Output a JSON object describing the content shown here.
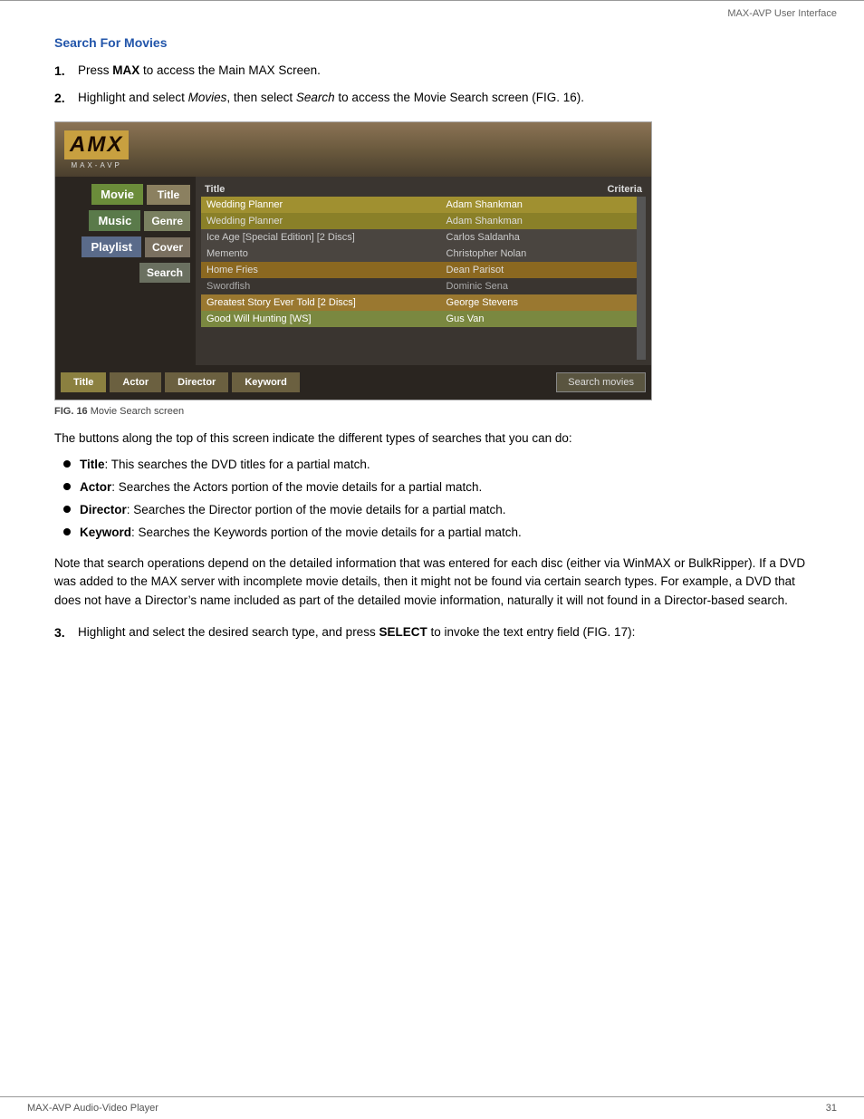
{
  "header": {
    "title": "MAX-AVP User Interface"
  },
  "section": {
    "heading": "Search For Movies",
    "step1": {
      "num": "1.",
      "text_before": "Press ",
      "bold": "MAX",
      "text_after": " to access the Main MAX Screen."
    },
    "step2": {
      "num": "2.",
      "text_before": "Highlight and select ",
      "italic1": "Movies",
      "text_middle": ", then select ",
      "italic2": "Search",
      "text_after": " to access the Movie Search screen (FIG. 16)."
    },
    "step3": {
      "num": "3.",
      "text_before": "Highlight and select the desired search type, and press ",
      "bold": "SELECT",
      "text_after": " to invoke the text entry field (FIG. 17):"
    }
  },
  "screenshot": {
    "logo_text": "AMX",
    "logo_sub": "MAX-AVP",
    "sidebar": {
      "movie_label": "Movie",
      "title_label": "Title",
      "music_label": "Music",
      "genre_label": "Genre",
      "playlist_label": "Playlist",
      "cover_label": "Cover",
      "search_label": "Search"
    },
    "table": {
      "col1": "Title",
      "col2": "Criteria",
      "rows": [
        {
          "title": "Wedding Planner",
          "criteria": "Adam Shankman",
          "style": "highlight"
        },
        {
          "title": "Wedding Planner",
          "criteria": "Adam Shankman",
          "style": "highlight2"
        },
        {
          "title": "Ice Age [Special Edition] [2 Discs]",
          "criteria": "Carlos Saldanha",
          "style": "normal"
        },
        {
          "title": "Memento",
          "criteria": "Christopher Nolan",
          "style": "normal"
        },
        {
          "title": "Home Fries",
          "criteria": "Dean Parisot",
          "style": "orange"
        },
        {
          "title": "Swordfish",
          "criteria": "Dominic Sena",
          "style": "dark"
        },
        {
          "title": "Greatest Story Ever Told [2 Discs]",
          "criteria": "George Stevens",
          "style": "orange-highlight"
        },
        {
          "title": "Good Will Hunting [WS]",
          "criteria": "Gus Van",
          "style": "highlight-green"
        }
      ]
    },
    "bottom_buttons": [
      "Title",
      "Actor",
      "Director",
      "Keyword"
    ],
    "search_movies_btn": "Search movies"
  },
  "fig_caption": {
    "label": "FIG. 16",
    "text": "Movie Search screen"
  },
  "body_paragraph": "The buttons along the top of this screen indicate the different types of searches that you can do:",
  "bullets": [
    {
      "bold": "Title",
      "text": ": This searches the DVD titles for a partial match."
    },
    {
      "bold": "Actor",
      "text": ": Searches the Actors portion of the movie details for a partial match."
    },
    {
      "bold": "Director",
      "text": ": Searches the Director portion of the movie details for a partial match."
    },
    {
      "bold": "Keyword",
      "text": ": Searches the Keywords portion of the movie details for a partial match."
    }
  ],
  "note_paragraph": "Note that search operations depend on the detailed information that was entered for each disc (either via WinMAX or BulkRipper). If a DVD was added to the MAX server with incomplete movie details, then it might not be found via certain search types. For example, a DVD that does not have a Director’s name included as part of the detailed movie information, naturally it will not found in a Director-based search.",
  "footer": {
    "left": "MAX-AVP Audio-Video Player",
    "right": "31"
  }
}
